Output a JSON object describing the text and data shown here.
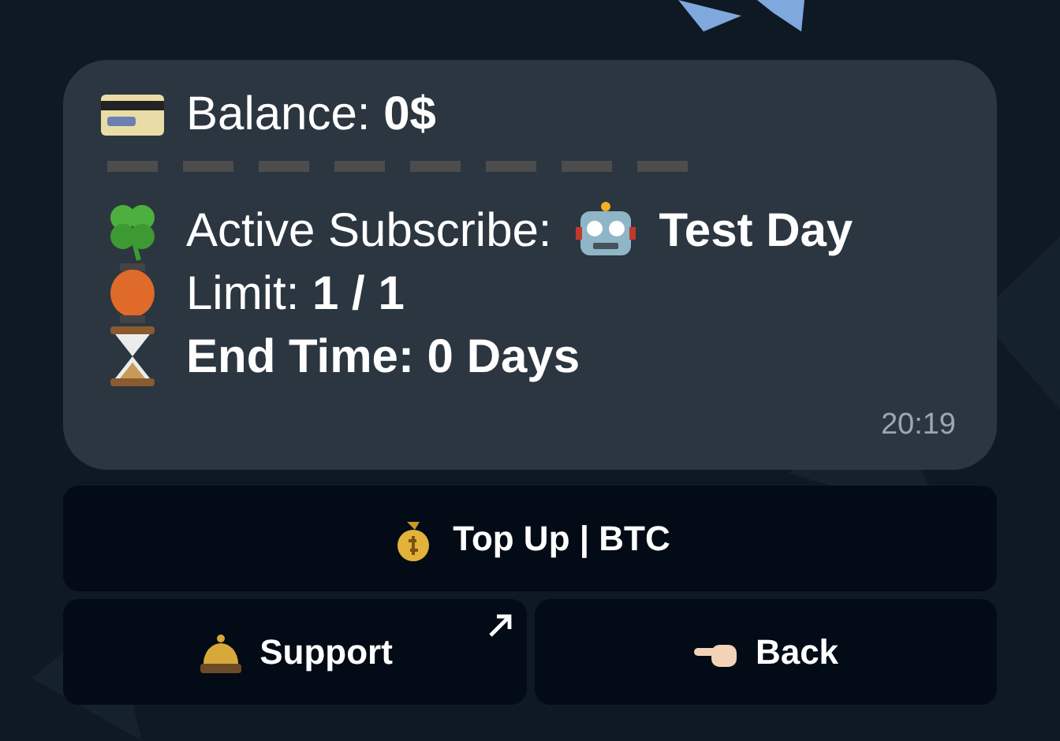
{
  "message": {
    "lines": [
      {
        "kind": "text",
        "text": "Balance: **0$**"
      },
      {
        "kind": "subscription",
        "label": "Active Subscribe:",
        "value": "Test Day"
      },
      {
        "kind": "text",
        "text": "Limit: **1 / 1**"
      },
      {
        "kind": "heading",
        "text": "End Time: 0 Days"
      }
    ],
    "time": "20:19"
  },
  "keyboard": [
    [
      {
        "label": "Top Up | BTC",
        "external": false
      }
    ],
    [
      {
        "label": "Support",
        "external": true
      },
      {
        "label": "Back",
        "external": false
      }
    ]
  ]
}
